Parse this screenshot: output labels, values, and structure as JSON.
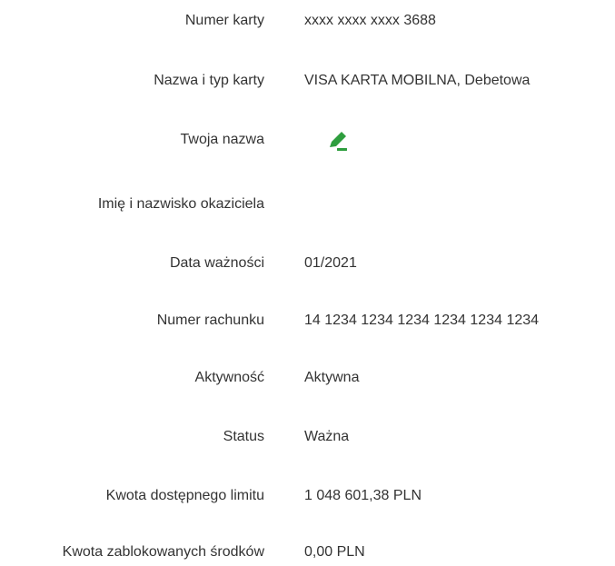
{
  "card_details": {
    "card_number": {
      "label": "Numer karty",
      "value": "xxxx xxxx xxxx 3688"
    },
    "card_name_type": {
      "label": "Nazwa i typ karty",
      "value": "VISA KARTA MOBILNA, Debetowa"
    },
    "your_name": {
      "label": "Twoja nazwa",
      "value": "",
      "edit_icon": "pencil-icon",
      "edit_icon_color": "#2e9e3e"
    },
    "holder_name": {
      "label": "Imię i nazwisko okaziciela",
      "value": ""
    },
    "expiry_date": {
      "label": "Data ważności",
      "value": "01/2021"
    },
    "account_number": {
      "label": "Numer rachunku",
      "value": "14 1234 1234 1234 1234 1234 1234"
    },
    "activity": {
      "label": "Aktywność",
      "value": "Aktywna"
    },
    "status": {
      "label": "Status",
      "value": "Ważna"
    },
    "available_limit": {
      "label": "Kwota dostępnego limitu",
      "value": "1 048 601,38 PLN"
    },
    "blocked_funds": {
      "label": "Kwota zablokowanych środków",
      "value": "0,00 PLN"
    }
  }
}
